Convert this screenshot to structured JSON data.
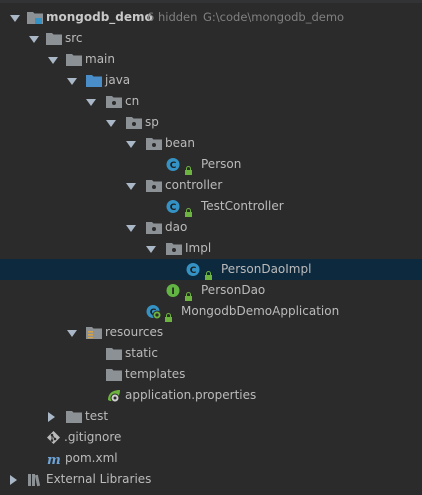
{
  "project": {
    "name": "mongodb_demo",
    "hidden_count": "6 hidden",
    "path": "G:\\code\\mongodb_demo"
  },
  "tree": {
    "src": "src",
    "main": "main",
    "java": "java",
    "cn": "cn",
    "sp": "sp",
    "bean": "bean",
    "person": "Person",
    "controller": "controller",
    "test_controller": "TestController",
    "dao": "dao",
    "impl": "Impl",
    "person_dao_impl": "PersonDaoImpl",
    "person_dao": "PersonDao",
    "app": "MongodbDemoApplication",
    "resources": "resources",
    "static": "static",
    "templates": "templates",
    "app_properties": "application.properties",
    "test": "test",
    "gitignore": ".gitignore",
    "pom": "pom.xml",
    "external_libraries": "External Libraries"
  },
  "icons": {
    "class_letter": "C",
    "interface_letter": "I"
  },
  "colors": {
    "background": "#2b2b2b",
    "selection": "#0d293e",
    "folder": "#8c9196",
    "source_folder": "#4a8ec9",
    "class_icon": "#3592c4",
    "interface_icon": "#62b543",
    "spring_green": "#6db33f"
  }
}
